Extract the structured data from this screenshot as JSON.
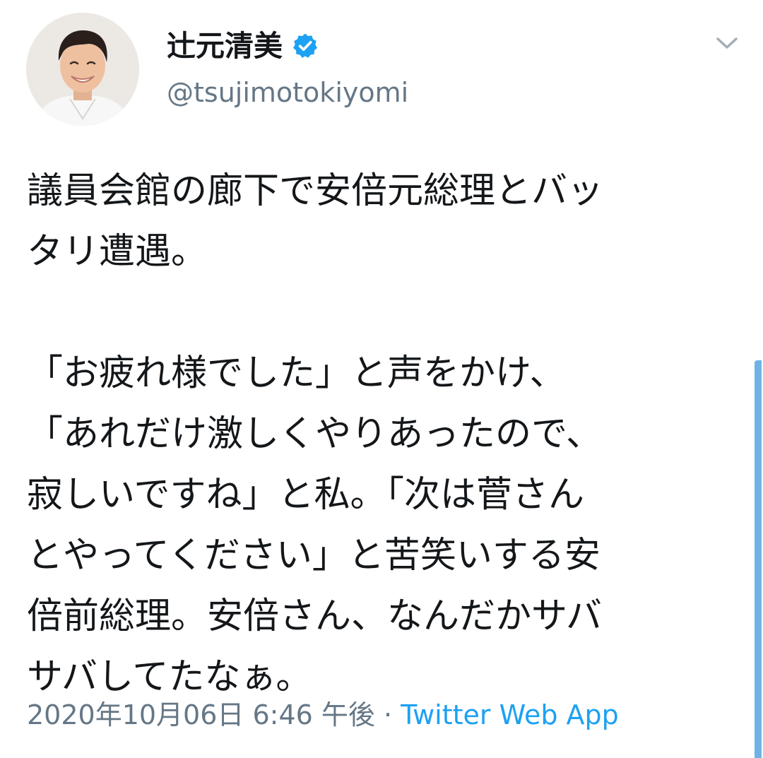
{
  "user": {
    "display_name": "辻元清美",
    "handle": "@tsujimotokiyomi"
  },
  "tweet": {
    "lines": [
      "議員会館の廊下で安倍元総理とバッ",
      "タリ遭遇。",
      "",
      "「お疲れ様でした」と声をかけ、",
      "「あれだけ激しくやりあったので、",
      "寂しいですね」と私。「次は菅さん",
      "とやってください」と苦笑いする安",
      "倍前総理。安倍さん、なんだかサバ",
      "サバしてたなぁ。"
    ],
    "timestamp": "2020年10月06日 6:46 午後",
    "separator": " · ",
    "source": "Twitter Web App"
  },
  "icons": {
    "verified": "verified-badge-icon",
    "more": "chevron-down-icon"
  },
  "colors": {
    "accent": "#1da1f2",
    "text": "#14171a",
    "secondary": "#657786"
  }
}
